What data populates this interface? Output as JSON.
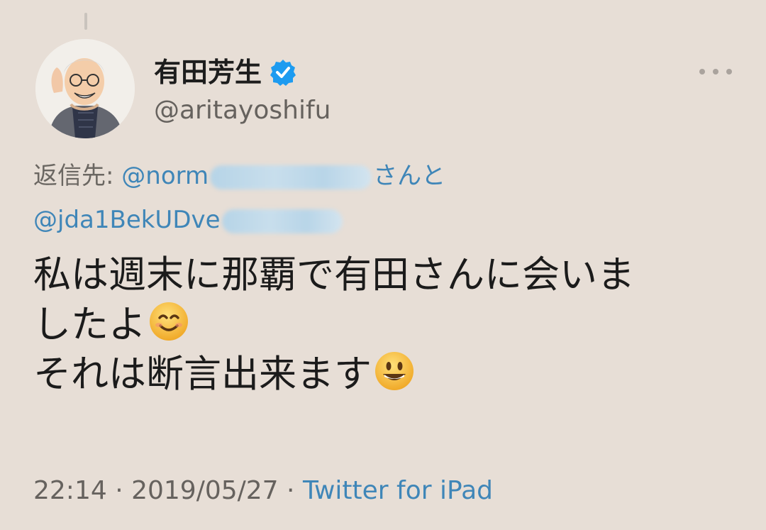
{
  "tweet": {
    "author": {
      "display_name": "有田芳生",
      "handle": "@aritayoshifu",
      "verified_icon": "verified-badge-icon",
      "avatar_icon": "profile-avatar"
    },
    "reply": {
      "prefix": "返信先: ",
      "mention_1_visible": "@norm",
      "joiner": "さんと",
      "mention_2_visible": "@jda1BekUDve"
    },
    "text_lines": [
      "私は週末に那覇で有田さんに会いま",
      "したよ",
      "それは断言出来ます"
    ],
    "emojis": [
      "smiling-face-with-smiling-eyes",
      "grinning-face"
    ],
    "meta": {
      "time": "22:14",
      "separator": " · ",
      "date": "2019/05/27",
      "source": "Twitter for iPad"
    },
    "more_icon": "more-options-icon"
  },
  "colors": {
    "background": "#e7ded6",
    "link": "#3f86b8",
    "muted": "#66625e",
    "verified": "#1d9bf0"
  }
}
